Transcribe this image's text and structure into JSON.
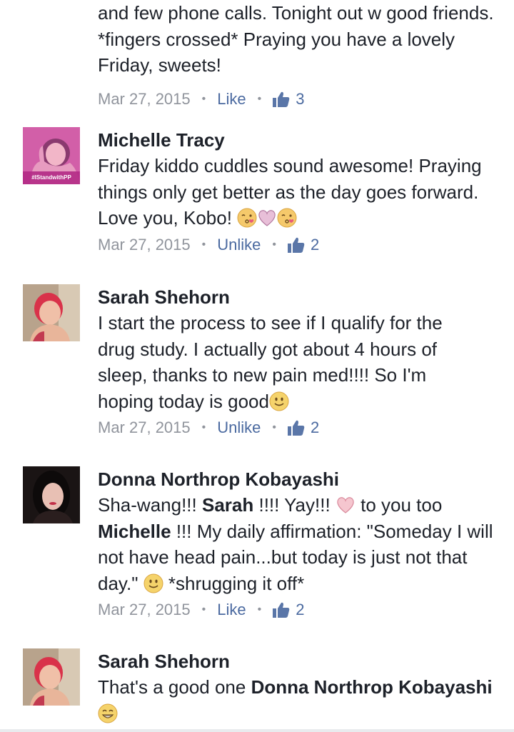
{
  "comments": [
    {
      "name": "",
      "text": "and few phone calls. Tonight out w good friends. *fingers crossed* Praying you have a lovely Friday, sweets!",
      "date": "Mar 27, 2015",
      "action": "Like",
      "likes": "3"
    },
    {
      "name": "Michelle Tracy",
      "text": "Friday kiddo cuddles sound awesome! Praying things only get better as the day goes forward. Love you, Kobo!",
      "emojis": [
        "kissing-heart-emoji",
        "pink-heart-emoji",
        "kissing-heart-emoji"
      ],
      "avatar_caption": "#IStandwithPP",
      "date": "Mar 27, 2015",
      "action": "Unlike",
      "likes": "2"
    },
    {
      "name": "Sarah Shehorn",
      "text_lines": [
        "I start the process to see if I qualify for the",
        "drug study.  I actually got about 4 hours of",
        "sleep, thanks to new pain med!!!!  So I'm",
        "hoping today is good"
      ],
      "emoji": "smile-emoji",
      "date": "Mar 27, 2015",
      "action": "Unlike",
      "likes": "2"
    },
    {
      "name": "Donna Northrop Kobayashi",
      "text_parts": {
        "p1": "Sha-wang!!! ",
        "mention1": "Sarah",
        "p2": " !!!! Yay!!! ",
        "p3": " to you too",
        "mention2": "Michelle",
        "p4": " !!! My daily affirmation: \"Someday I will not have head pain...but today is just not that day.\" ",
        "p5": " *shrugging it off*"
      },
      "date": "Mar 27, 2015",
      "action": "Like",
      "likes": "2"
    },
    {
      "name": "Sarah Shehorn",
      "text_parts": {
        "p1": "That's a good one ",
        "mention1": "Donna Northrop Kobayashi"
      },
      "emoji": "grin-emoji"
    }
  ],
  "colors": {
    "name_text": "#1d2129",
    "meta_gray": "#90949c",
    "action_blue": "#4b6aa0",
    "like_blue": "#5a76a8"
  }
}
